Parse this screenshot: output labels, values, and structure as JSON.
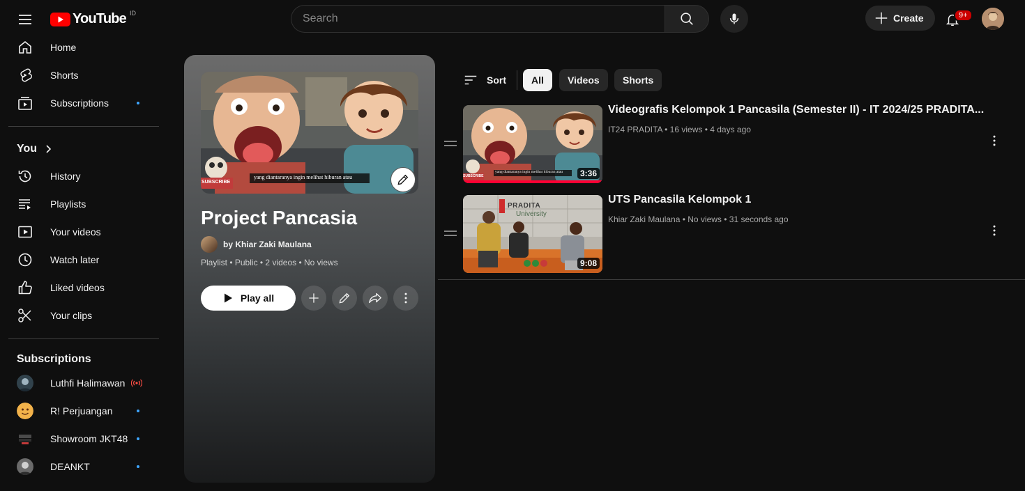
{
  "colors": {
    "bg": "#0f0f0f",
    "brand_red": "#ff0000",
    "subscription_dot": "#3ea6ff",
    "live_red": "#ff4e45"
  },
  "header": {
    "logo_text": "YouTube",
    "country_code": "ID",
    "search_placeholder": "Search",
    "create_label": "Create",
    "notifications_badge": "9+"
  },
  "sidebar": {
    "main": [
      {
        "label": "Home",
        "icon": "home-icon"
      },
      {
        "label": "Shorts",
        "icon": "shorts-icon"
      },
      {
        "label": "Subscriptions",
        "icon": "subscriptions-icon"
      }
    ],
    "you_heading": "You",
    "you_items": [
      {
        "label": "History",
        "icon": "history-icon"
      },
      {
        "label": "Playlists",
        "icon": "playlists-icon"
      },
      {
        "label": "Your videos",
        "icon": "your-videos-icon"
      },
      {
        "label": "Watch later",
        "icon": "watch-later-icon"
      },
      {
        "label": "Liked videos",
        "icon": "like-icon"
      },
      {
        "label": "Your clips",
        "icon": "scissors-icon"
      }
    ],
    "subscriptions_heading": "Subscriptions",
    "subscriptions": [
      {
        "name": "Luthfi Halimawan",
        "live": true
      },
      {
        "name": "R! Perjuangan",
        "live": false
      },
      {
        "name": "Showroom JKT48",
        "live": false
      },
      {
        "name": "DEANKT",
        "live": false
      }
    ]
  },
  "playlist": {
    "title": "Project Pancasia",
    "owner": "by Khiar Zaki Maulana",
    "meta": "Playlist • Public • 2 videos • No views",
    "play_all_label": "Play all",
    "thumb_caption": "yang diantaranya ingin melihat hiburan atau",
    "thumb_subscribe": "SUBSCRIBE"
  },
  "filters": {
    "sort_label": "Sort",
    "chips": [
      "All",
      "Videos",
      "Shorts"
    ],
    "active": "All"
  },
  "videos": [
    {
      "title": "Videografis Kelompok 1 Pancasila (Semester II) - IT 2024/25 PRADITA...",
      "meta": "IT24 PRADITA • 16 views • 4 days ago",
      "duration": "3:36",
      "caption": "yang diantaranya ingin melihat hiburan atau",
      "subscribe": "SUBSCRIBE",
      "watched_fraction": 1.0
    },
    {
      "title": "UTS Pancasila Kelompok 1",
      "meta": "Khiar Zaki Maulana • No views • 31 seconds ago",
      "duration": "9:08",
      "sign_text": "PRADITA",
      "sign_sub": "University",
      "watched_fraction": 0
    }
  ]
}
